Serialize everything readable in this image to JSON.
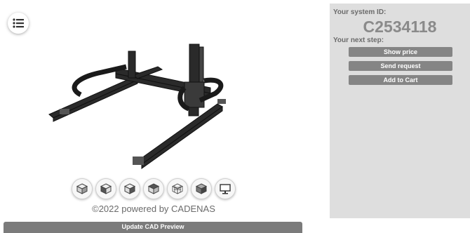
{
  "viewer": {
    "menu_icon": "list-icon",
    "view_buttons": [
      {
        "name": "iso-cube-view-button",
        "icon": "cube-icon"
      },
      {
        "name": "front-view-button",
        "icon": "cube-front-icon"
      },
      {
        "name": "side-view-button",
        "icon": "cube-side-icon"
      },
      {
        "name": "top-view-button",
        "icon": "cube-top-icon"
      },
      {
        "name": "wireframe-view-button",
        "icon": "wireframe-cube-icon"
      },
      {
        "name": "shaded-view-button",
        "icon": "shaded-cube-icon"
      },
      {
        "name": "fullscreen-button",
        "icon": "monitor-icon"
      }
    ],
    "copyright": "©2022 powered by CADENAS",
    "update_label": "Update CAD Preview"
  },
  "panel": {
    "system_id_label": "Your system ID:",
    "system_id": "C2534118",
    "next_step_label": "Your next step:",
    "buttons": {
      "show_price": "Show price",
      "send_request": "Send request",
      "add_to_cart": "Add to Cart"
    }
  },
  "colors": {
    "panel_bg": "#dedede",
    "button_bg": "#858585",
    "update_bar_bg": "#7b7b7b"
  }
}
